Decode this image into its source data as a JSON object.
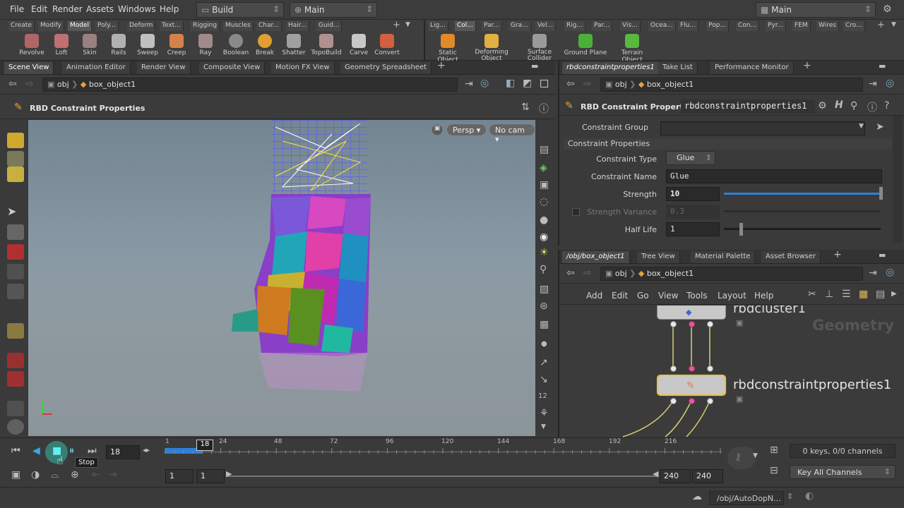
{
  "menubar": {
    "items": [
      "File",
      "Edit",
      "Render",
      "Assets",
      "Windows",
      "Help"
    ],
    "desktop": "Build",
    "context": "Main",
    "right_desktop": "Main"
  },
  "shelf_left": {
    "tabs": [
      "Create",
      "Modify",
      "Model",
      "Poly...",
      "Deform",
      "Text...",
      "Rigging",
      "Muscles",
      "Char...",
      "Hair...",
      "Guid..."
    ],
    "active_tab": "Model",
    "tools": [
      "Revolve",
      "Loft",
      "Skin",
      "Rails",
      "Sweep",
      "Creep",
      "Ray",
      "Boolean",
      "Break",
      "Shatter",
      "TopoBuild",
      "Carve",
      "Convert"
    ]
  },
  "shelf_right": {
    "tabs": [
      "Lig...",
      "Col...",
      "Par...",
      "Gra...",
      "Vel...",
      "Rig...",
      "Par...",
      "Vis...",
      "Ocea...",
      "Flu...",
      "Pop...",
      "Con...",
      "Pyr...",
      "FEM",
      "Wires",
      "Cro..."
    ],
    "active_tab": "Col...",
    "tools": [
      {
        "label": "Static Object",
        "color": "#e08a2a"
      },
      {
        "label": "Deforming Object",
        "color": "#e0b040"
      },
      {
        "label": "Surface Collider",
        "color": "#9a9a9a"
      },
      {
        "label": "Ground Plane",
        "color": "#4caf3a"
      },
      {
        "label": "Terrain Object",
        "color": "#58b840"
      }
    ]
  },
  "left_pane": {
    "tabs": [
      "Scene View",
      "Animation Editor",
      "Render View",
      "Composite View",
      "Motion FX View",
      "Geometry Spreadsheet"
    ],
    "path": {
      "root": "obj",
      "node": "box_object1"
    },
    "title": "RBD Constraint Properties",
    "viewport": {
      "persp": "Persp",
      "cam": "No cam"
    }
  },
  "right_top": {
    "tabs": [
      "rbdconstraintproperties1",
      "Take List",
      "Performance Monitor"
    ],
    "path": {
      "root": "obj",
      "node": "box_object1"
    },
    "node_type": "RBD Constraint Properties",
    "node_name": "rbdconstraintproperties1",
    "params": {
      "constraint_group_label": "Constraint Group",
      "constraint_group_value": "",
      "section": "Constraint Properties",
      "type_label": "Constraint Type",
      "type_value": "Glue",
      "name_label": "Constraint Name",
      "name_value": "Glue",
      "strength_label": "Strength",
      "strength_value": "10",
      "strength_fill": 1.0,
      "variance_label": "Strength Variance",
      "variance_value": "0.3",
      "halflife_label": "Half Life",
      "halflife_value": "1",
      "halflife_fill": 0.1
    }
  },
  "right_bottom": {
    "tabs": [
      "/obj/box_object1",
      "Tree View",
      "Material Palette",
      "Asset Browser"
    ],
    "path": {
      "root": "obj",
      "node": "box_object1"
    },
    "menu": [
      "Add",
      "Edit",
      "Go",
      "View",
      "Tools",
      "Layout",
      "Help"
    ],
    "watermark": "Geometry",
    "nodes": [
      {
        "name": "rbdcluster1"
      },
      {
        "name": "rbdconstraintproperties1"
      }
    ]
  },
  "timeline": {
    "current_frame": "18",
    "ticks": [
      "1",
      "24",
      "48",
      "72",
      "96",
      "120",
      "144",
      "168",
      "192",
      "216"
    ],
    "keys_text": "0 keys, 0/0 channels",
    "key_all": "Key All Channels",
    "range_start": "1",
    "range_start2": "1",
    "range_end": "240",
    "range_end2": "240",
    "tooltip": "Stop"
  },
  "status": {
    "path": "/obj/AutoDopN..."
  },
  "brand": {
    "accent": "#f0c030",
    "playbar_blue": "#2f7fd8"
  }
}
